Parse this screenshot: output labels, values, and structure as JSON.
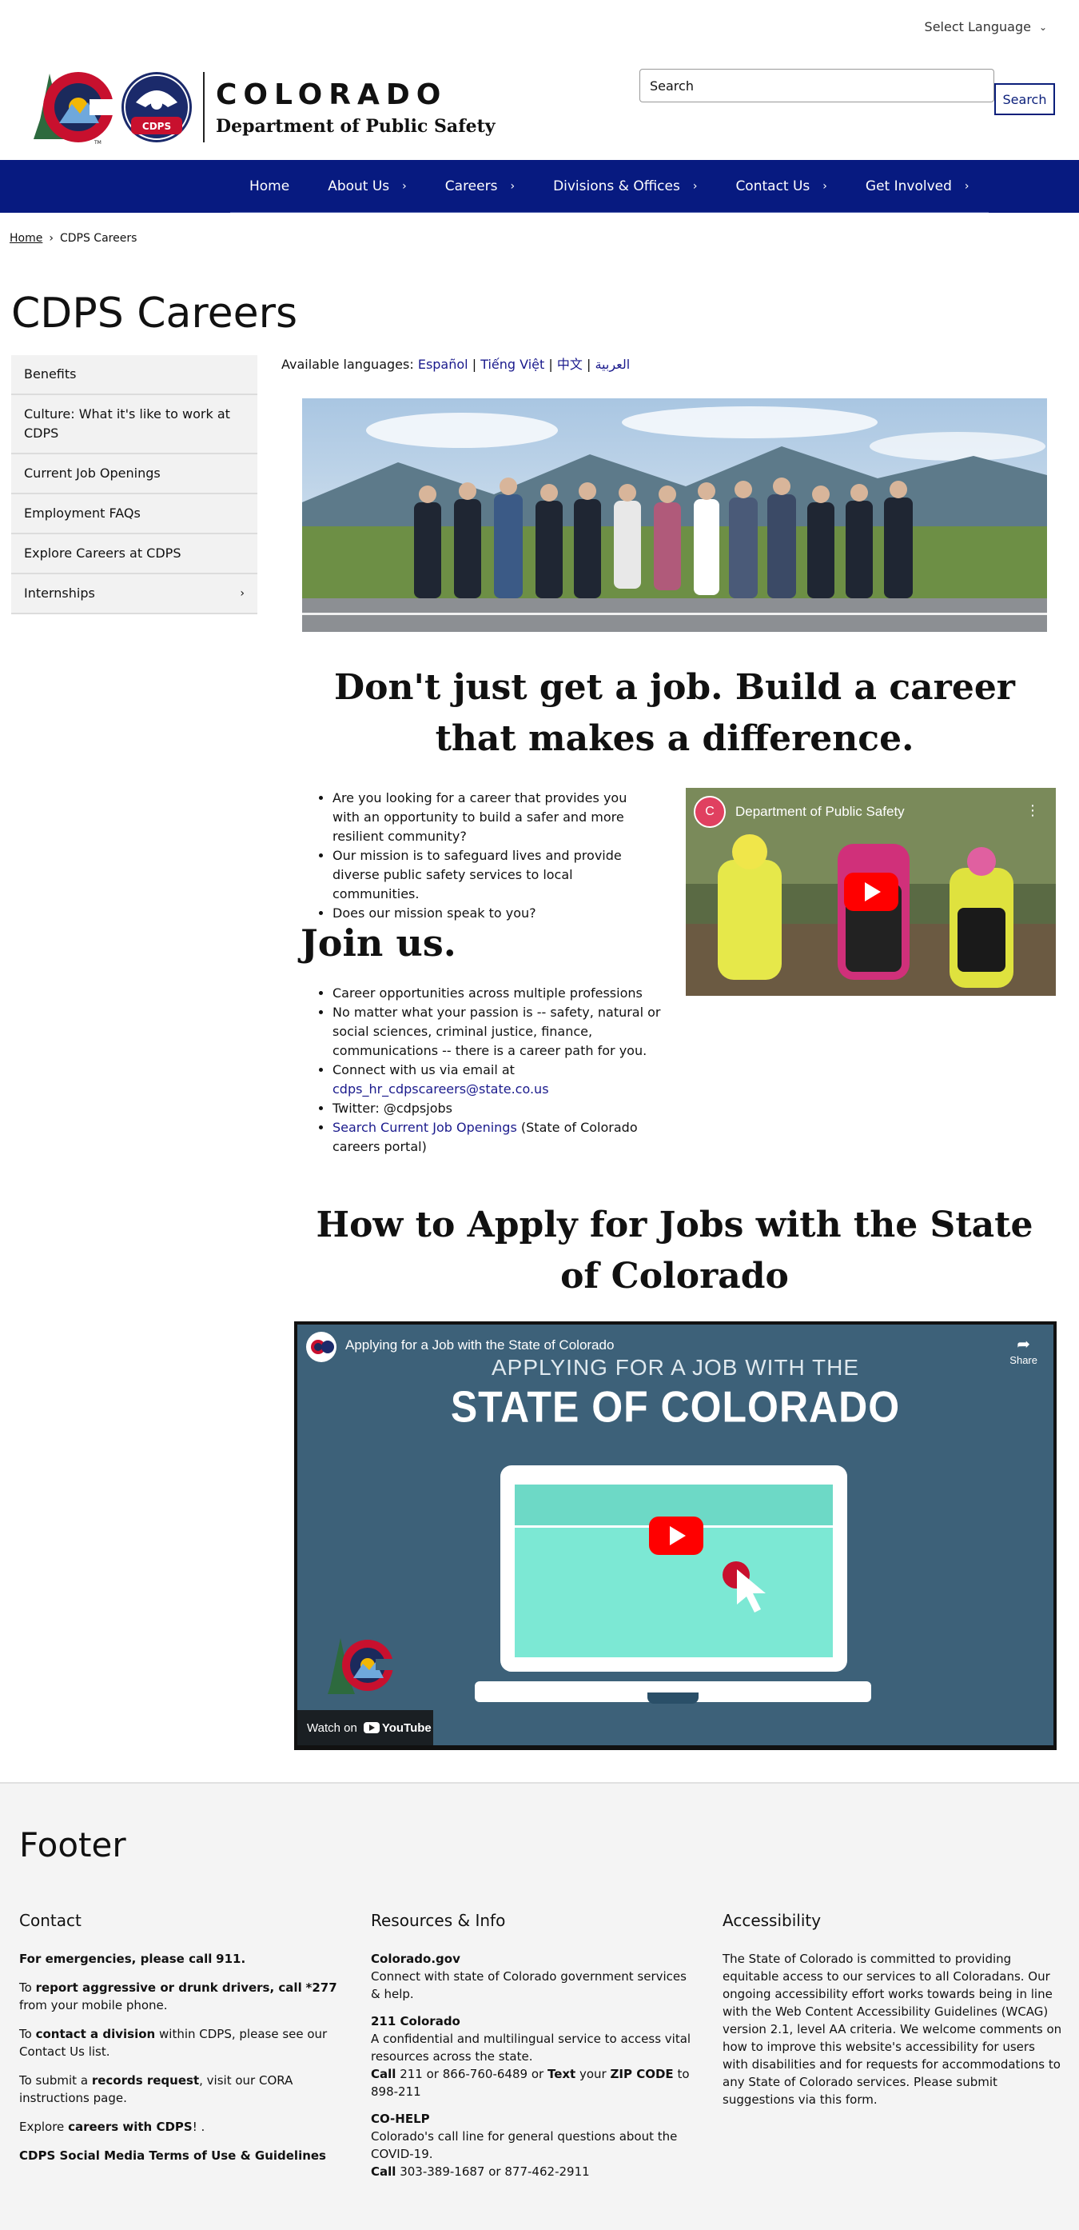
{
  "topbar": {
    "language_select": "Select Language"
  },
  "header": {
    "state_name": "COLORADO",
    "dept_name": "Department of Public Safety",
    "cdps_badge": "CDPS",
    "tm": "TM",
    "search_value": "Search",
    "search_button": "Search"
  },
  "nav": [
    {
      "label": "Home"
    },
    {
      "label": "About Us"
    },
    {
      "label": "Careers"
    },
    {
      "label": "Divisions & Offices"
    },
    {
      "label": "Contact Us"
    },
    {
      "label": "Get Involved"
    }
  ],
  "breadcrumb": {
    "home": "Home",
    "separator": "›",
    "current": "CDPS Careers"
  },
  "page_title": "CDPS Careers",
  "sidebar": [
    {
      "label": "Benefits"
    },
    {
      "label": "Culture: What it's like to work at CDPS"
    },
    {
      "label": "Current Job Openings"
    },
    {
      "label": "Employment FAQs"
    },
    {
      "label": "Explore Careers at CDPS"
    },
    {
      "label": "Internships"
    }
  ],
  "languages": {
    "prefix": "Available languages:",
    "es": "Español",
    "vi": "Tiếng Việt",
    "zh": "中文",
    "ar": "العربية",
    "sep": "|"
  },
  "main": {
    "headline": "Don't just get a job. Build a career that makes a difference.",
    "bullets1": [
      "Are you looking for a career that provides you with an opportunity to build a safer and more resilient community?",
      "Our mission is to safeguard lives and provide diverse public safety services to local communities.",
      "Does our mission speak to you?"
    ],
    "join": "Join us.",
    "bullets2": {
      "b1": "Career opportunities across multiple professions",
      "b2": "No matter what your passion is -- safety, natural or social sciences, criminal justice, finance, communications --  there is a career path for you.",
      "b3_prefix": "Connect with us via email at",
      "b3_email": "cdps_hr_cdpscareers@state.co.us",
      "b4": "Twitter: @cdpsjobs",
      "b5_link": "Search Current Job Openings",
      "b5_suffix": "(State of Colorado careers portal)"
    },
    "video1": {
      "channel_initial": "C",
      "title": "Department of Public Safety"
    },
    "apply_heading": "How to Apply for Jobs with the State of Colorado",
    "video2": {
      "title": "Applying for a Job with the State of Colorado",
      "share": "Share",
      "line1": "APPLYING FOR A JOB WITH THE",
      "line2": "STATE OF COLORADO",
      "watch_on": "Watch on",
      "youtube": "YouTube"
    }
  },
  "footer": {
    "title": "Footer",
    "contact": {
      "heading": "Contact",
      "emergency_prefix": "For emergencies, please call",
      "emergency_num": "911",
      "report_pre": "To",
      "report_bold": "report aggressive or drunk drivers, call",
      "report_num": "*277",
      "report_post": "from your mobile phone.",
      "division_pre": "To",
      "division_bold": "contact a division",
      "division_mid": "within CDPS, please see our",
      "division_link": "Contact Us list",
      "records_pre": "To submit a",
      "records_bold": "records request",
      "records_mid": ", visit our",
      "records_link": "CORA instructions page",
      "explore_pre": "Explore",
      "explore_link": "careers with CDPS",
      "explore_post": "! .",
      "terms": "CDPS Social Media Terms of Use & Guidelines"
    },
    "resources": {
      "heading": "Resources & Info",
      "colorado_gov": "Colorado.gov",
      "colorado_gov_desc": "Connect with state of Colorado government services & help.",
      "co211": "211 Colorado",
      "co211_desc": "A confidential and multilingual service to access vital resources across the state.",
      "call": "Call",
      "n211": "211",
      "or": "or",
      "n866": "866-760-6489",
      "text": "Text",
      "your": "your",
      "zip": "ZIP CODE",
      "to": "to 898-211",
      "cohelp": "CO-HELP",
      "cohelp_desc": "Colorado's call line for general questions about the COVID-19.",
      "n303": "303-389-1687",
      "n877": "877-462-2911"
    },
    "accessibility": {
      "heading": "Accessibility",
      "body": "The State of Colorado is committed to providing equitable access to our services to all Coloradans. Our ongoing accessibility effort works towards being in line with the Web Content Accessibility Guidelines (WCAG) version 2.1, level AA criteria. We welcome comments on how to improve this website's accessibility for users with disabilities and for requests for accommodations to any State of Colorado services.",
      "link": "Please submit suggestions via this form",
      "end": "."
    }
  },
  "colors": {
    "nav_bg": "#071a80",
    "accent_red": "#c8102e",
    "footer_bg": "#f4f4f4"
  },
  "icons": [
    "chevron-down-icon",
    "chevron-right-icon",
    "play-icon",
    "share-icon",
    "more-vert-icon",
    "youtube-logo"
  ]
}
